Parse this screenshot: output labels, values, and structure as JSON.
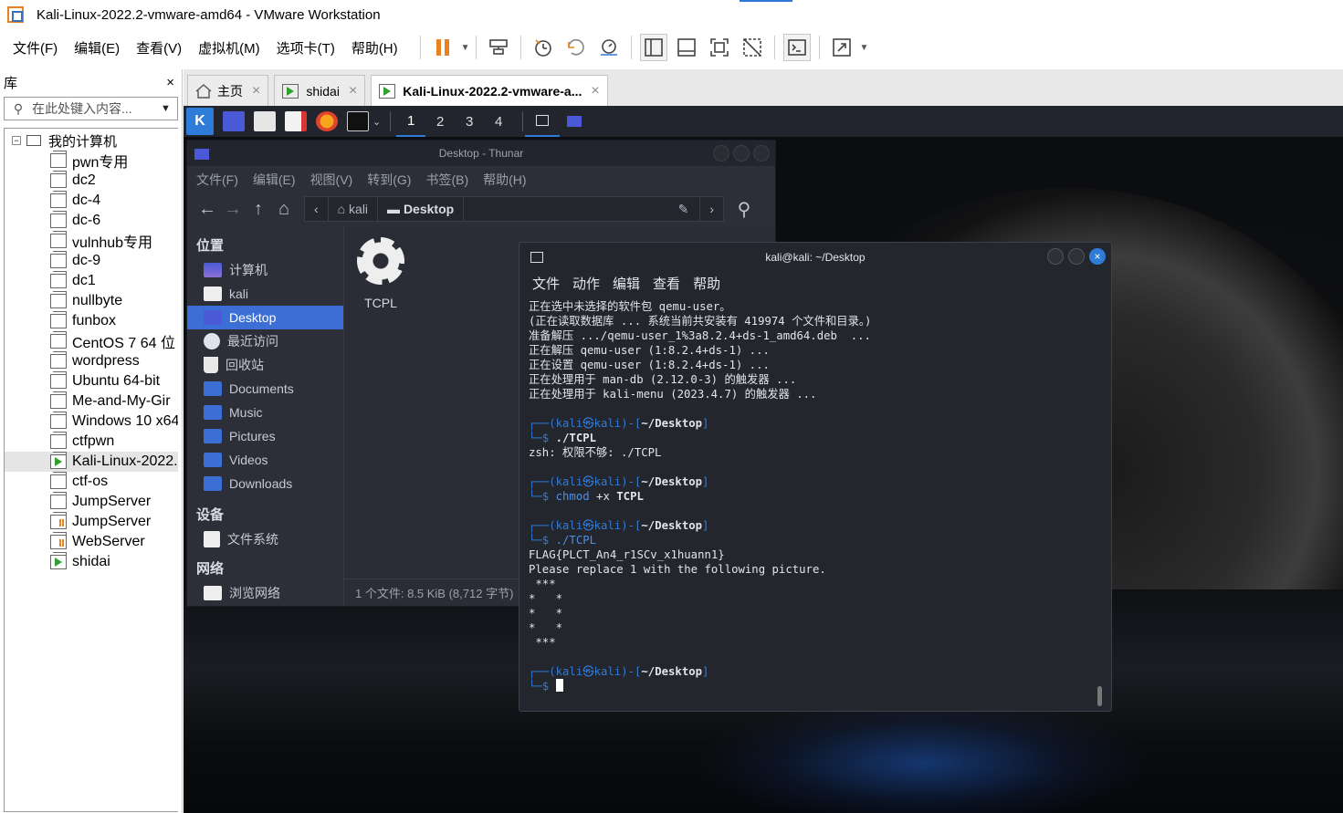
{
  "window": {
    "title": "Kali-Linux-2022.2-vmware-amd64 - VMware Workstation"
  },
  "menubar": {
    "items": [
      "文件(F)",
      "编辑(E)",
      "查看(V)",
      "虚拟机(M)",
      "选项卡(T)",
      "帮助(H)"
    ]
  },
  "toolbar": {
    "icons": [
      "pause-icon",
      "send-ctrl-alt-del-icon",
      "snapshot-icon",
      "revert-snapshot-icon",
      "snapshot-manager-icon",
      "library-view-icon",
      "thumbnail-view-icon",
      "fullscreen-icon",
      "unity-icon",
      "console-icon",
      "stretch-icon"
    ],
    "accent": "#e8821e"
  },
  "library": {
    "title": "库",
    "close": "×",
    "search_placeholder": "在此处键入内容...",
    "root": "我的计算机",
    "items": [
      {
        "label": "pwn专用",
        "state": "off"
      },
      {
        "label": "dc2",
        "state": "off"
      },
      {
        "label": "dc-4",
        "state": "off"
      },
      {
        "label": "dc-6",
        "state": "off"
      },
      {
        "label": "vulnhub专用",
        "state": "off"
      },
      {
        "label": "dc-9",
        "state": "off"
      },
      {
        "label": "dc1",
        "state": "off"
      },
      {
        "label": "nullbyte",
        "state": "off"
      },
      {
        "label": "funbox",
        "state": "off"
      },
      {
        "label": "CentOS 7 64 位",
        "state": "off"
      },
      {
        "label": "wordpress",
        "state": "off"
      },
      {
        "label": "Ubuntu 64-bit",
        "state": "off"
      },
      {
        "label": "Me-and-My-Gir",
        "state": "off"
      },
      {
        "label": "Windows 10 x64",
        "state": "off"
      },
      {
        "label": "ctfpwn",
        "state": "off"
      },
      {
        "label": "Kali-Linux-2022.",
        "state": "running"
      },
      {
        "label": "ctf-os",
        "state": "off"
      },
      {
        "label": "JumpServer",
        "state": "off"
      },
      {
        "label": "JumpServer",
        "state": "suspended"
      },
      {
        "label": "WebServer",
        "state": "suspended"
      },
      {
        "label": "shidai",
        "state": "running"
      }
    ]
  },
  "tabs": [
    {
      "label": "主页",
      "close": "×"
    },
    {
      "label": "shidai",
      "close": "×"
    },
    {
      "label": "Kali-Linux-2022.2-vmware-a...",
      "close": "×"
    }
  ],
  "kali_panel": {
    "workspaces": [
      "1",
      "2",
      "3",
      "4"
    ],
    "active_workspace": "1"
  },
  "thunar": {
    "title": "Desktop - Thunar",
    "menu": [
      "文件(F)",
      "编辑(E)",
      "视图(V)",
      "转到(G)",
      "书签(B)",
      "帮助(H)"
    ],
    "path": [
      "kali",
      "Desktop"
    ],
    "sections": {
      "places": "位置",
      "devices": "设备",
      "network": "网络"
    },
    "places": [
      {
        "label": "计算机",
        "icon": "computer-icon"
      },
      {
        "label": "kali",
        "icon": "home-folder-icon"
      },
      {
        "label": "Desktop",
        "icon": "desktop-icon"
      },
      {
        "label": "最近访问",
        "icon": "recent-icon"
      },
      {
        "label": "回收站",
        "icon": "trash-icon"
      },
      {
        "label": "Documents",
        "icon": "documents-folder-icon"
      },
      {
        "label": "Music",
        "icon": "music-folder-icon"
      },
      {
        "label": "Pictures",
        "icon": "pictures-folder-icon"
      },
      {
        "label": "Videos",
        "icon": "videos-folder-icon"
      },
      {
        "label": "Downloads",
        "icon": "downloads-folder-icon"
      }
    ],
    "devices": [
      {
        "label": "文件系统",
        "icon": "drive-icon"
      }
    ],
    "network": [
      {
        "label": "浏览网络",
        "icon": "network-icon"
      }
    ],
    "file": {
      "name": "TCPL",
      "icon": "executable-gear-icon"
    },
    "status": "1 个文件: 8.5 KiB (8,712 字节)"
  },
  "terminal": {
    "title": "kali@kali: ~/Desktop",
    "menu": [
      "文件",
      "动作",
      "编辑",
      "查看",
      "帮助"
    ],
    "lines": [
      "正在选中未选择的软件包 qemu-user。",
      "(正在读取数据库 ... 系统当前共安装有 419974 个文件和目录。)",
      "准备解压 .../qemu-user_1%3a8.2.4+ds-1_amd64.deb  ...",
      "正在解压 qemu-user (1:8.2.4+ds-1) ...",
      "正在设置 qemu-user (1:8.2.4+ds-1) ...",
      "正在处理用于 man-db (2.12.0-3) 的触发器 ...",
      "正在处理用于 kali-menu (2023.4.7) 的触发器 ..."
    ],
    "prompt_user": "kali",
    "prompt_host": "kali",
    "prompt_dir": "~/Desktop",
    "cmd1": "./TCPL",
    "out1": "zsh: 权限不够: ./TCPL",
    "cmd2_a": "chmod",
    "cmd2_b": " +x ",
    "cmd2_c": "TCPL",
    "cmd3": "./TCPL",
    "out3": [
      "FLAG{PLCT_An4_r1SCv_x1huann1}",
      "Please replace 1 with the following picture.",
      " ***",
      "*   *",
      "*   *",
      "*   *",
      " ***"
    ]
  }
}
